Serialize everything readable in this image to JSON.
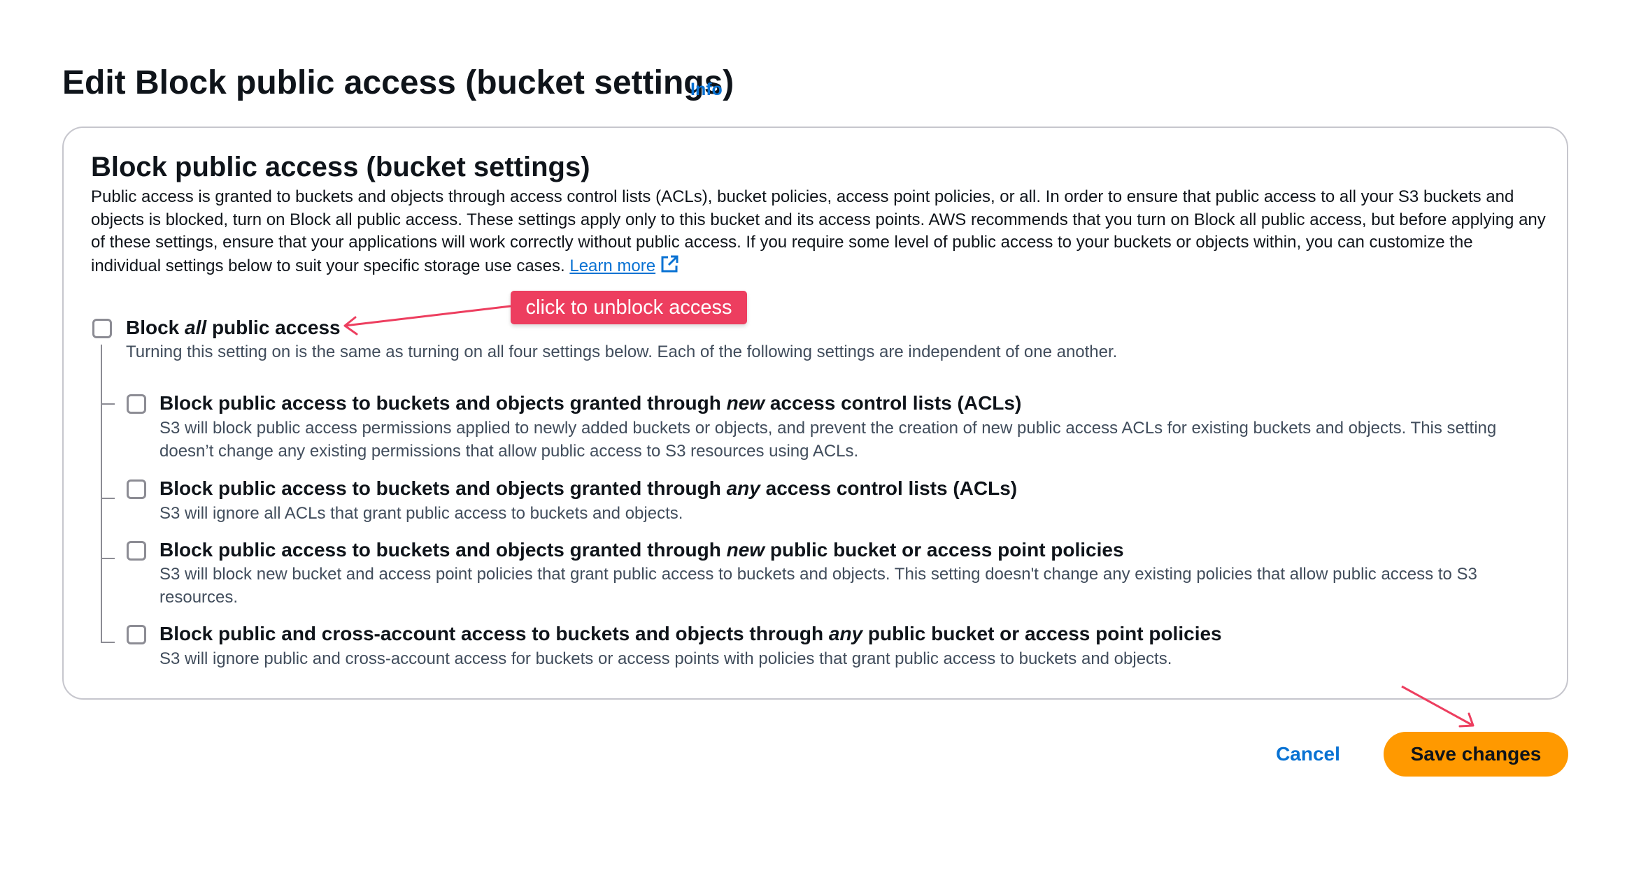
{
  "header": {
    "title": "Edit Block public access (bucket settings)",
    "info_label": "Info"
  },
  "panel": {
    "title": "Block public access (bucket settings)",
    "description": "Public access is granted to buckets and objects through access control lists (ACLs), bucket policies, access point policies, or all. In order to ensure that public access to all your S3 buckets and objects is blocked, turn on Block all public access. These settings apply only to this bucket and its access points. AWS recommends that you turn on Block all public access, but before applying any of these settings, ensure that your applications will work correctly without public access. If you require some level of public access to your buckets or objects within, you can customize the individual settings below to suit your specific storage use cases.",
    "learn_more_label": "Learn more"
  },
  "options": {
    "block_all": {
      "label_pre": "Block ",
      "label_em": "all",
      "label_post": " public access",
      "description": "Turning this setting on is the same as turning on all four settings below. Each of the following settings are independent of one another.",
      "checked": false
    },
    "items": [
      {
        "label_pre": "Block public access to buckets and objects granted through ",
        "label_em": "new",
        "label_post": " access control lists (ACLs)",
        "description": "S3 will block public access permissions applied to newly added buckets or objects, and prevent the creation of new public access ACLs for existing buckets and objects. This setting doesn’t change any existing permissions that allow public access to S3 resources using ACLs.",
        "checked": false
      },
      {
        "label_pre": "Block public access to buckets and objects granted through ",
        "label_em": "any",
        "label_post": " access control lists (ACLs)",
        "description": "S3 will ignore all ACLs that grant public access to buckets and objects.",
        "checked": false
      },
      {
        "label_pre": "Block public access to buckets and objects granted through ",
        "label_em": "new",
        "label_post": " public bucket or access point policies",
        "description": "S3 will block new bucket and access point policies that grant public access to buckets and objects. This setting doesn't change any existing policies that allow public access to S3 resources.",
        "checked": false
      },
      {
        "label_pre": "Block public and cross-account access to buckets and objects through ",
        "label_em": "any",
        "label_post": " public bucket or access point policies",
        "description": "S3 will ignore public and cross-account access for buckets or access points with policies that grant public access to buckets and objects.",
        "checked": false
      }
    ]
  },
  "annotation": {
    "text": "click to unblock access",
    "color": "#ed3e5f"
  },
  "footer": {
    "cancel_label": "Cancel",
    "save_label": "Save changes"
  },
  "colors": {
    "link": "#0972d3",
    "primary_button": "#ff9900",
    "text": "#0f141a",
    "secondary_text": "#414d5c"
  },
  "icons": {
    "external_link": "external-link-icon",
    "annotation_arrow": "arrow-icon"
  }
}
